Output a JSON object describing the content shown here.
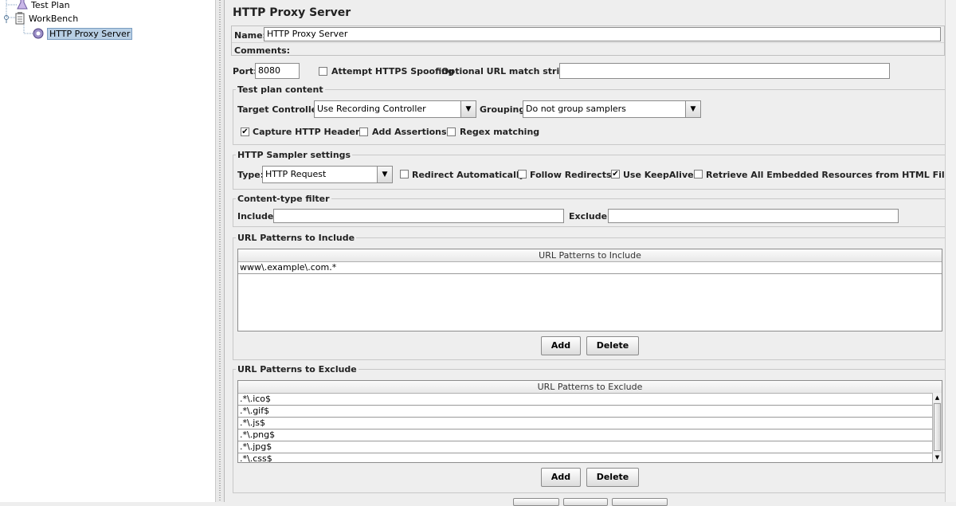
{
  "tree": {
    "items": [
      {
        "label": "Test Plan"
      },
      {
        "label": "WorkBench"
      },
      {
        "label": "HTTP Proxy Server"
      }
    ]
  },
  "panel": {
    "title": "HTTP Proxy Server",
    "name_label": "Name:",
    "name_value": "HTTP Proxy Server",
    "comments_label": "Comments:",
    "port_label": "Port:",
    "port_value": "8080",
    "https_spoofing_label": "Attempt HTTPS Spoofing",
    "url_match_label": "Optional URL match string:",
    "url_match_value": ""
  },
  "test_plan_content": {
    "legend": "Test plan content",
    "target_label": "Target Controller:",
    "target_value": "Use Recording Controller",
    "grouping_label": "Grouping:",
    "grouping_value": "Do not group samplers",
    "capture_headers_label": "Capture HTTP Headers",
    "add_assertions_label": "Add Assertions",
    "regex_label": "Regex matching"
  },
  "sampler": {
    "legend": "HTTP Sampler settings",
    "type_label": "Type:",
    "type_value": "HTTP Request",
    "redirect_auto_label": "Redirect Automatically",
    "follow_redirects_label": "Follow Redirects",
    "keepalive_label": "Use KeepAlive",
    "retrieve_label": "Retrieve All Embedded Resources from HTML Files"
  },
  "content_filter": {
    "legend": "Content-type filter",
    "include_label": "Include:",
    "include_value": "",
    "exclude_label": "Exclude:",
    "exclude_value": ""
  },
  "include_patterns": {
    "legend": "URL Patterns to Include",
    "header": "URL Patterns to Include",
    "rows": [
      "www\\.example\\.com.*"
    ],
    "add_label": "Add",
    "delete_label": "Delete"
  },
  "exclude_patterns": {
    "legend": "URL Patterns to Exclude",
    "header": "URL Patterns to Exclude",
    "rows": [
      ".*\\.ico$",
      ".*\\.gif$",
      ".*\\.js$",
      ".*\\.png$",
      ".*\\.jpg$",
      ".*\\.css$"
    ],
    "add_label": "Add",
    "delete_label": "Delete"
  }
}
